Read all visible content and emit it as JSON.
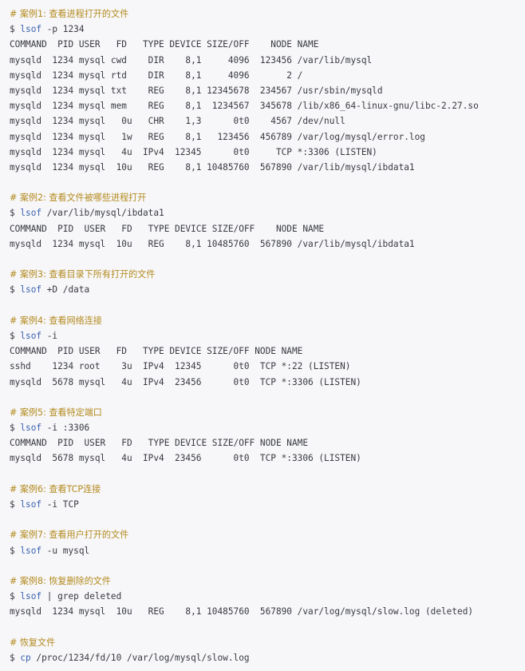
{
  "lines": [
    {
      "kind": "comment",
      "text": "# 案例1: 查看进程打开的文件"
    },
    {
      "kind": "cmd",
      "prefix": "$ ",
      "keyword": "lsof",
      "rest": " -p 1234"
    },
    {
      "kind": "out",
      "text": "COMMAND  PID USER   FD   TYPE DEVICE SIZE/OFF    NODE NAME"
    },
    {
      "kind": "out",
      "text": "mysqld  1234 mysql cwd    DIR    8,1     4096  123456 /var/lib/mysql"
    },
    {
      "kind": "out",
      "text": "mysqld  1234 mysql rtd    DIR    8,1     4096       2 /"
    },
    {
      "kind": "out",
      "text": "mysqld  1234 mysql txt    REG    8,1 12345678  234567 /usr/sbin/mysqld"
    },
    {
      "kind": "out",
      "text": "mysqld  1234 mysql mem    REG    8,1  1234567  345678 /lib/x86_64-linux-gnu/libc-2.27.so"
    },
    {
      "kind": "out",
      "text": "mysqld  1234 mysql   0u   CHR    1,3      0t0    4567 /dev/null"
    },
    {
      "kind": "out",
      "text": "mysqld  1234 mysql   1w   REG    8,1   123456  456789 /var/log/mysql/error.log"
    },
    {
      "kind": "out",
      "text": "mysqld  1234 mysql   4u  IPv4  12345      0t0     TCP *:3306 (LISTEN)"
    },
    {
      "kind": "out",
      "text": "mysqld  1234 mysql  10u   REG    8,1 10485760  567890 /var/lib/mysql/ibdata1"
    },
    {
      "kind": "blank",
      "text": ""
    },
    {
      "kind": "comment",
      "text": "# 案例2: 查看文件被哪些进程打开"
    },
    {
      "kind": "cmd",
      "prefix": "$ ",
      "keyword": "lsof",
      "rest": " /var/lib/mysql/ibdata1"
    },
    {
      "kind": "out",
      "text": "COMMAND  PID  USER   FD   TYPE DEVICE SIZE/OFF    NODE NAME"
    },
    {
      "kind": "out",
      "text": "mysqld  1234 mysql  10u   REG    8,1 10485760  567890 /var/lib/mysql/ibdata1"
    },
    {
      "kind": "blank",
      "text": ""
    },
    {
      "kind": "comment",
      "text": "# 案例3: 查看目录下所有打开的文件"
    },
    {
      "kind": "cmd",
      "prefix": "$ ",
      "keyword": "lsof",
      "rest": " +D /data"
    },
    {
      "kind": "blank",
      "text": ""
    },
    {
      "kind": "comment",
      "text": "# 案例4: 查看网络连接"
    },
    {
      "kind": "cmd",
      "prefix": "$ ",
      "keyword": "lsof",
      "rest": " -i"
    },
    {
      "kind": "out",
      "text": "COMMAND  PID USER   FD   TYPE DEVICE SIZE/OFF NODE NAME"
    },
    {
      "kind": "out",
      "text": "sshd    1234 root    3u  IPv4  12345      0t0  TCP *:22 (LISTEN)"
    },
    {
      "kind": "out",
      "text": "mysqld  5678 mysql   4u  IPv4  23456      0t0  TCP *:3306 (LISTEN)"
    },
    {
      "kind": "blank",
      "text": ""
    },
    {
      "kind": "comment",
      "text": "# 案例5: 查看特定端口"
    },
    {
      "kind": "cmd",
      "prefix": "$ ",
      "keyword": "lsof",
      "rest": " -i :3306"
    },
    {
      "kind": "out",
      "text": "COMMAND  PID  USER   FD   TYPE DEVICE SIZE/OFF NODE NAME"
    },
    {
      "kind": "out",
      "text": "mysqld  5678 mysql   4u  IPv4  23456      0t0  TCP *:3306 (LISTEN)"
    },
    {
      "kind": "blank",
      "text": ""
    },
    {
      "kind": "comment",
      "text": "# 案例6: 查看TCP连接"
    },
    {
      "kind": "cmd",
      "prefix": "$ ",
      "keyword": "lsof",
      "rest": " -i TCP"
    },
    {
      "kind": "blank",
      "text": ""
    },
    {
      "kind": "comment",
      "text": "# 案例7: 查看用户打开的文件"
    },
    {
      "kind": "cmd",
      "prefix": "$ ",
      "keyword": "lsof",
      "rest": " -u mysql"
    },
    {
      "kind": "blank",
      "text": ""
    },
    {
      "kind": "comment",
      "text": "# 案例8: 恢复删除的文件"
    },
    {
      "kind": "cmd",
      "prefix": "$ ",
      "keyword": "lsof",
      "rest": " | grep deleted"
    },
    {
      "kind": "out",
      "text": "mysqld  1234 mysql  10u   REG    8,1 10485760  567890 /var/log/mysql/slow.log (deleted)"
    },
    {
      "kind": "blank",
      "text": ""
    },
    {
      "kind": "comment",
      "text": "# 恢复文件"
    },
    {
      "kind": "cmd",
      "prefix": "$ ",
      "keyword": "cp",
      "rest": " /proc/1234/fd/10 /var/log/mysql/slow.log"
    }
  ],
  "colors": {
    "background": "#f7f7f9",
    "comment": "#b38a1e",
    "keyword": "#3a62b0",
    "text": "#383a42"
  }
}
